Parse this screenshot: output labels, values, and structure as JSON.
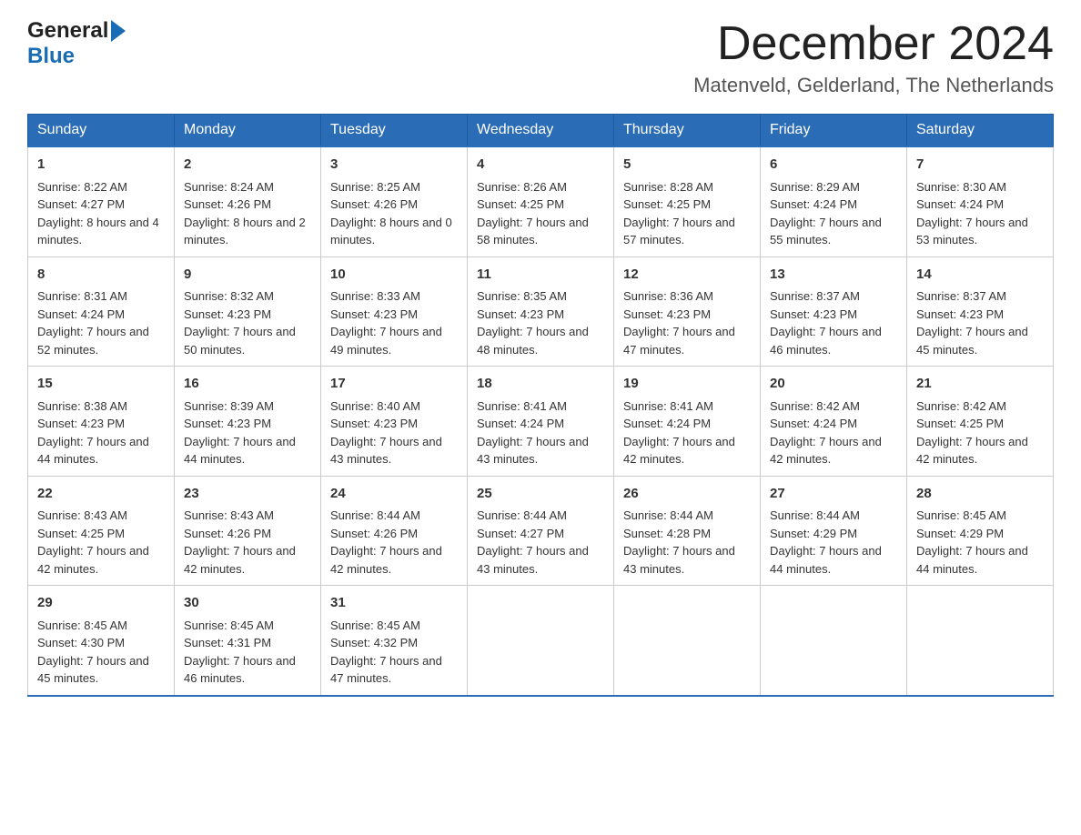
{
  "logo": {
    "general": "General",
    "blue": "Blue",
    "arrow": "▶"
  },
  "title": {
    "month": "December 2024",
    "location": "Matenveld, Gelderland, The Netherlands"
  },
  "header": {
    "days": [
      "Sunday",
      "Monday",
      "Tuesday",
      "Wednesday",
      "Thursday",
      "Friday",
      "Saturday"
    ]
  },
  "weeks": [
    [
      {
        "day": "1",
        "sunrise": "8:22 AM",
        "sunset": "4:27 PM",
        "daylight": "8 hours and 4 minutes."
      },
      {
        "day": "2",
        "sunrise": "8:24 AM",
        "sunset": "4:26 PM",
        "daylight": "8 hours and 2 minutes."
      },
      {
        "day": "3",
        "sunrise": "8:25 AM",
        "sunset": "4:26 PM",
        "daylight": "8 hours and 0 minutes."
      },
      {
        "day": "4",
        "sunrise": "8:26 AM",
        "sunset": "4:25 PM",
        "daylight": "7 hours and 58 minutes."
      },
      {
        "day": "5",
        "sunrise": "8:28 AM",
        "sunset": "4:25 PM",
        "daylight": "7 hours and 57 minutes."
      },
      {
        "day": "6",
        "sunrise": "8:29 AM",
        "sunset": "4:24 PM",
        "daylight": "7 hours and 55 minutes."
      },
      {
        "day": "7",
        "sunrise": "8:30 AM",
        "sunset": "4:24 PM",
        "daylight": "7 hours and 53 minutes."
      }
    ],
    [
      {
        "day": "8",
        "sunrise": "8:31 AM",
        "sunset": "4:24 PM",
        "daylight": "7 hours and 52 minutes."
      },
      {
        "day": "9",
        "sunrise": "8:32 AM",
        "sunset": "4:23 PM",
        "daylight": "7 hours and 50 minutes."
      },
      {
        "day": "10",
        "sunrise": "8:33 AM",
        "sunset": "4:23 PM",
        "daylight": "7 hours and 49 minutes."
      },
      {
        "day": "11",
        "sunrise": "8:35 AM",
        "sunset": "4:23 PM",
        "daylight": "7 hours and 48 minutes."
      },
      {
        "day": "12",
        "sunrise": "8:36 AM",
        "sunset": "4:23 PM",
        "daylight": "7 hours and 47 minutes."
      },
      {
        "day": "13",
        "sunrise": "8:37 AM",
        "sunset": "4:23 PM",
        "daylight": "7 hours and 46 minutes."
      },
      {
        "day": "14",
        "sunrise": "8:37 AM",
        "sunset": "4:23 PM",
        "daylight": "7 hours and 45 minutes."
      }
    ],
    [
      {
        "day": "15",
        "sunrise": "8:38 AM",
        "sunset": "4:23 PM",
        "daylight": "7 hours and 44 minutes."
      },
      {
        "day": "16",
        "sunrise": "8:39 AM",
        "sunset": "4:23 PM",
        "daylight": "7 hours and 44 minutes."
      },
      {
        "day": "17",
        "sunrise": "8:40 AM",
        "sunset": "4:23 PM",
        "daylight": "7 hours and 43 minutes."
      },
      {
        "day": "18",
        "sunrise": "8:41 AM",
        "sunset": "4:24 PM",
        "daylight": "7 hours and 43 minutes."
      },
      {
        "day": "19",
        "sunrise": "8:41 AM",
        "sunset": "4:24 PM",
        "daylight": "7 hours and 42 minutes."
      },
      {
        "day": "20",
        "sunrise": "8:42 AM",
        "sunset": "4:24 PM",
        "daylight": "7 hours and 42 minutes."
      },
      {
        "day": "21",
        "sunrise": "8:42 AM",
        "sunset": "4:25 PM",
        "daylight": "7 hours and 42 minutes."
      }
    ],
    [
      {
        "day": "22",
        "sunrise": "8:43 AM",
        "sunset": "4:25 PM",
        "daylight": "7 hours and 42 minutes."
      },
      {
        "day": "23",
        "sunrise": "8:43 AM",
        "sunset": "4:26 PM",
        "daylight": "7 hours and 42 minutes."
      },
      {
        "day": "24",
        "sunrise": "8:44 AM",
        "sunset": "4:26 PM",
        "daylight": "7 hours and 42 minutes."
      },
      {
        "day": "25",
        "sunrise": "8:44 AM",
        "sunset": "4:27 PM",
        "daylight": "7 hours and 43 minutes."
      },
      {
        "day": "26",
        "sunrise": "8:44 AM",
        "sunset": "4:28 PM",
        "daylight": "7 hours and 43 minutes."
      },
      {
        "day": "27",
        "sunrise": "8:44 AM",
        "sunset": "4:29 PM",
        "daylight": "7 hours and 44 minutes."
      },
      {
        "day": "28",
        "sunrise": "8:45 AM",
        "sunset": "4:29 PM",
        "daylight": "7 hours and 44 minutes."
      }
    ],
    [
      {
        "day": "29",
        "sunrise": "8:45 AM",
        "sunset": "4:30 PM",
        "daylight": "7 hours and 45 minutes."
      },
      {
        "day": "30",
        "sunrise": "8:45 AM",
        "sunset": "4:31 PM",
        "daylight": "7 hours and 46 minutes."
      },
      {
        "day": "31",
        "sunrise": "8:45 AM",
        "sunset": "4:32 PM",
        "daylight": "7 hours and 47 minutes."
      },
      null,
      null,
      null,
      null
    ]
  ],
  "labels": {
    "sunrise": "Sunrise:",
    "sunset": "Sunset:",
    "daylight": "Daylight:"
  }
}
